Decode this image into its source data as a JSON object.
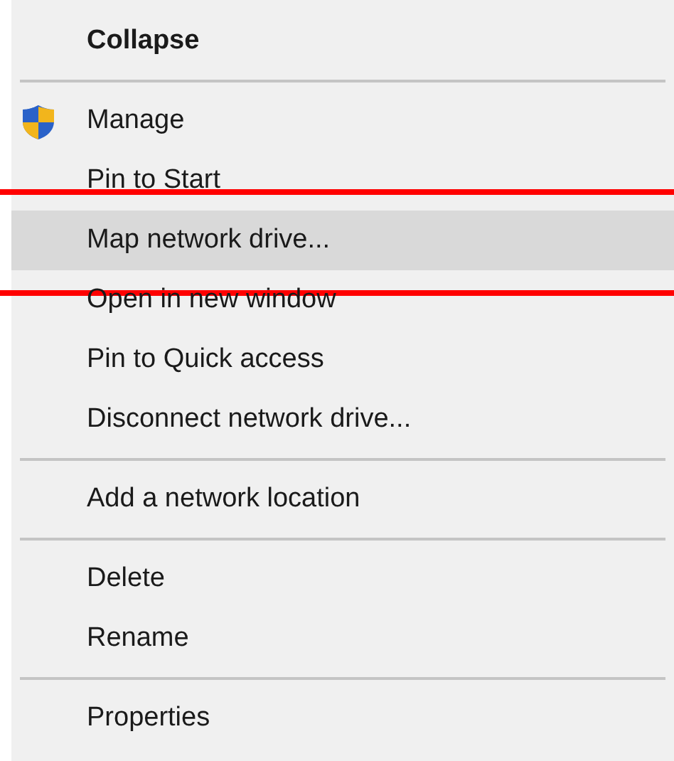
{
  "menu": {
    "sections": [
      {
        "items": [
          {
            "label": "Collapse",
            "default": true
          }
        ]
      },
      {
        "items": [
          {
            "label": "Manage",
            "shield": true
          },
          {
            "label": "Pin to Start"
          },
          {
            "label": "Map network drive...",
            "selected": true,
            "marked": true
          },
          {
            "label": "Open in new window"
          },
          {
            "label": "Pin to Quick access"
          },
          {
            "label": "Disconnect network drive..."
          }
        ]
      },
      {
        "items": [
          {
            "label": "Add a network location"
          }
        ]
      },
      {
        "items": [
          {
            "label": "Delete"
          },
          {
            "label": "Rename"
          }
        ]
      },
      {
        "items": [
          {
            "label": "Properties"
          }
        ]
      }
    ]
  }
}
